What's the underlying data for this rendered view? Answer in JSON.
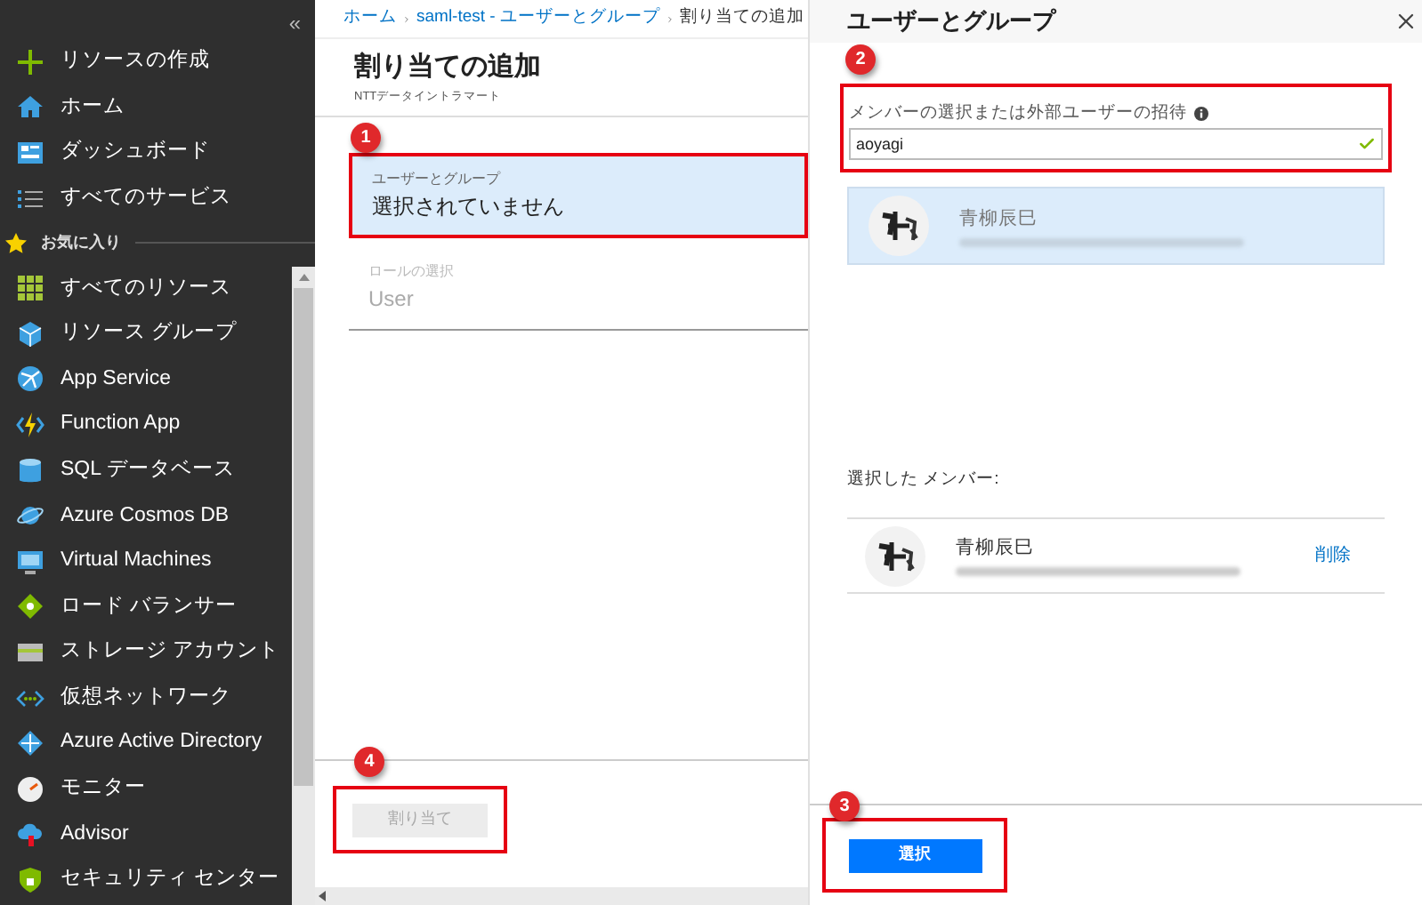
{
  "sidebar": {
    "collapse": "«",
    "items": [
      {
        "kind": "link",
        "label": "リソースの作成"
      },
      {
        "kind": "link",
        "label": "ホーム"
      },
      {
        "kind": "link",
        "label": "ダッシュボード"
      },
      {
        "kind": "link",
        "label": "すべてのサービス"
      },
      {
        "kind": "header",
        "label": "お気に入り"
      },
      {
        "kind": "link",
        "label": "すべてのリソース"
      },
      {
        "kind": "link",
        "label": "リソース グループ"
      },
      {
        "kind": "link",
        "label": "App Service"
      },
      {
        "kind": "link",
        "label": "Function App"
      },
      {
        "kind": "link",
        "label": "SQL データベース"
      },
      {
        "kind": "link",
        "label": "Azure Cosmos DB"
      },
      {
        "kind": "link",
        "label": "Virtual Machines"
      },
      {
        "kind": "link",
        "label": "ロード バランサー"
      },
      {
        "kind": "link",
        "label": "ストレージ アカウント"
      },
      {
        "kind": "link",
        "label": "仮想ネットワーク"
      },
      {
        "kind": "link",
        "label": "Azure Active Directory"
      },
      {
        "kind": "link",
        "label": "モニター"
      },
      {
        "kind": "link",
        "label": "Advisor"
      },
      {
        "kind": "link",
        "label": "セキュリティ センター"
      }
    ]
  },
  "breadcrumb": [
    "ホーム",
    "saml-test - ユーザーとグループ",
    "割り当ての追加"
  ],
  "blade": {
    "title": "割り当ての追加",
    "subtitle": "NTTデータイントラマート",
    "fields": [
      {
        "label": "ユーザーとグループ",
        "value": "選択されていません",
        "selected": true,
        "disabled": false
      },
      {
        "label": "ロールの選択",
        "value": "User",
        "selected": false,
        "disabled": true
      }
    ],
    "assign_button": {
      "label": "割り当て",
      "disabled": true
    }
  },
  "panel": {
    "title": "ユーザーとグループ",
    "search": {
      "label": "メンバーの選択または外部ユーザーの招待",
      "value": "aoyagi",
      "valid": true
    },
    "results": [
      {
        "name": "青柳辰巳",
        "selected": true
      }
    ],
    "selected_heading": "選択した メンバー:",
    "members": [
      {
        "name": "青柳辰巳",
        "remove": "削除"
      }
    ],
    "select_button": "選択"
  },
  "annotations": [
    "1",
    "2",
    "3",
    "4"
  ]
}
